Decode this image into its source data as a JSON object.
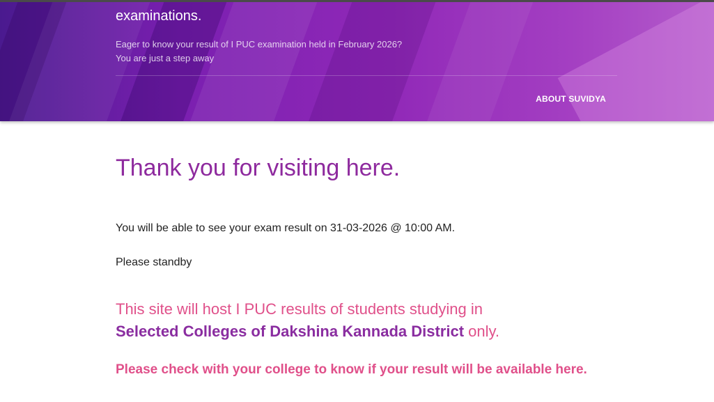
{
  "hero": {
    "heading": "examinations.",
    "subtitle_line1": "Eager to know your result of I PUC examination held in February 2026?",
    "subtitle_line2": "You are just a step away",
    "nav_link": "ABOUT SUVIDYA"
  },
  "main": {
    "title": "Thank you for visiting here.",
    "message_result": "You will be able to see your exam result on 31-03-2026 @ 10:00 AM.",
    "message_standby": "Please standby",
    "notice_line1": "This site will host I PUC results of students studying in",
    "notice_highlight": "Selected Colleges of Dakshina Kannada District",
    "notice_suffix": " only.",
    "check_message": "Please check with your college to know if your result will be available here."
  },
  "colors": {
    "title": "#8e2a9e",
    "notice": "#e0508a",
    "highlight": "#8a2da0",
    "hero_gradient_start": "#4a1a8f",
    "hero_gradient_end": "#b45ccb"
  }
}
